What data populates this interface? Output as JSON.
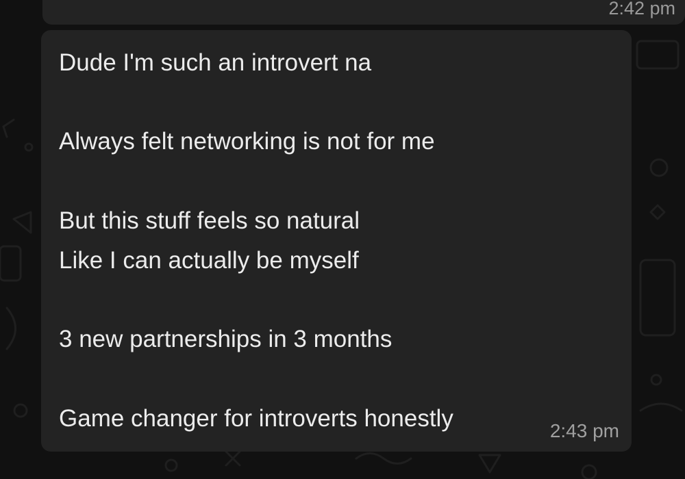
{
  "previous_message": {
    "timestamp": "2:42 pm"
  },
  "message": {
    "lines": [
      "Dude I'm such an introvert na",
      "Always felt networking is not for me",
      "But this stuff feels so natural",
      "Like I can actually be myself",
      "3 new partnerships in 3 months",
      "Game changer for introverts honestly"
    ],
    "timestamp": "2:43 pm"
  },
  "colors": {
    "background": "#111111",
    "bubble": "#232323",
    "text": "#ececec",
    "timestamp": "#a0a0a0"
  }
}
